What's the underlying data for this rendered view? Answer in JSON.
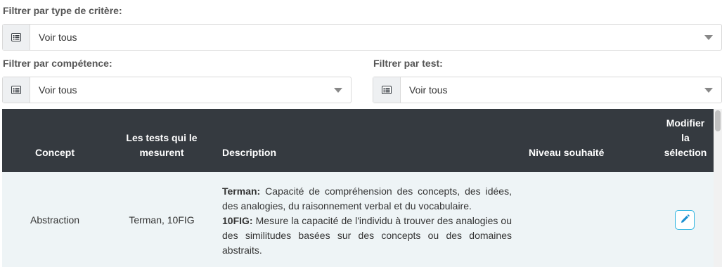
{
  "filters": {
    "critere": {
      "label": "Filtrer par type de critère:",
      "value": "Voir tous"
    },
    "competence": {
      "label": "Filtrer par compétence:",
      "value": "Voir tous"
    },
    "test": {
      "label": "Filtrer par test:",
      "value": "Voir tous"
    }
  },
  "table": {
    "headers": {
      "concept": "Concept",
      "tests_line1": "Les tests qui le",
      "tests_line2": "mesurent",
      "description": "Description",
      "niveau": "Niveau souhaité",
      "modifier_line1": "Modifier",
      "modifier_line2": "la",
      "modifier_line3": "sélection"
    },
    "rows": [
      {
        "concept": "Abstraction",
        "tests": "Terman, 10FIG",
        "desc1_name": "Terman:",
        "desc1_text": " Capacité de compréhension des concepts, des idées, des analogies, du raisonnement verbal et du vocabulaire.",
        "desc2_name": "10FIG:",
        "desc2_text": " Mesure la capacité de l'individu à trouver des analogies ou des similitudes basées sur des concepts ou des domaines abstraits.",
        "niveau": ""
      }
    ]
  },
  "icons": {
    "addon": "list-icon",
    "caret": "chevron-down-icon",
    "edit": "pencil-icon"
  },
  "colors": {
    "header_bg": "#353a40",
    "row_bg": "#eef4f6",
    "accent": "#2bb3e0"
  }
}
